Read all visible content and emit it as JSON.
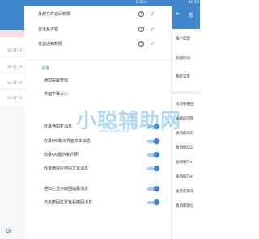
{
  "left": {
    "status_time": "",
    "times": [
      "10:57:19",
      "10:57:19",
      "10:57:19",
      "10:57:19"
    ],
    "settings_icon": "gear-icon"
  },
  "middle": {
    "status_time": "0.6K/s",
    "permissions": [
      {
        "label": "外部文件访问权限",
        "icon": "help-icon",
        "status": "granted"
      },
      {
        "label": "显示悬浮窗",
        "icon": "help-icon",
        "status": "granted"
      },
      {
        "label": "发送通知权限",
        "icon": "help-icon",
        "status": "granted"
      }
    ],
    "help_glyph": "?",
    "check_glyph": "✓",
    "section_title": "设置",
    "plain_rows": [
      "通知提醒管理",
      "界面字体大小"
    ],
    "toggle_rows": [
      {
        "label": "收录通知栏消息",
        "on": true
      },
      {
        "label": "收录QQ聊天界面文本消息",
        "on": true
      },
      {
        "label": "收录QQ图片和闪照",
        "on": true
      },
      {
        "label": "收录微信应用内文本消息",
        "on": true
      },
      {
        "label": "通知栏显示撤回提醒消息",
        "on": true
      },
      {
        "label": "点击撤回位置查看撤回消息",
        "on": true
      }
    ]
  },
  "right": {
    "status_time": "10:59",
    "title": "我",
    "back_glyph": "←",
    "items_top": [
      "账户类型",
      "到期时间",
      "我的订单"
    ],
    "items_bottom": [
      "找到的撤回",
      "破解的闪照",
      "收到的QQ",
      "收到的QQ",
      "收到的Tim",
      "收到的Tim",
      "收到的微信",
      "收到的微信"
    ]
  },
  "watermark": {
    "text": "小聪辅助网",
    "url": "www.Xcb8.com"
  },
  "colors": {
    "primary": "#3f86cc",
    "check": "#3ab06a",
    "toggle_track": "#a9c8ee"
  }
}
